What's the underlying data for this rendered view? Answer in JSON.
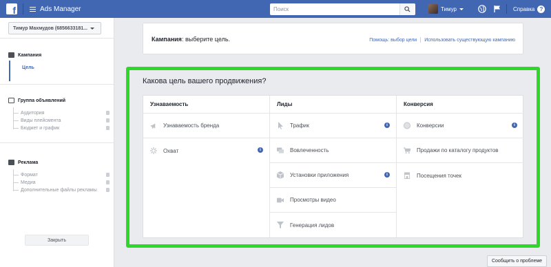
{
  "topbar": {
    "app_title": "Ads Manager",
    "search_placeholder": "Поиск",
    "user_name": "Тимур",
    "help_label": "Справка"
  },
  "sidebar": {
    "account_label": "Тимур Махмудов (6856633181...",
    "sections": [
      {
        "title": "Кампания",
        "active_sub": "Цель"
      },
      {
        "title": "Группа объявлений",
        "items": [
          "Аудитория",
          "Виды плейсмента",
          "Бюджет и график"
        ]
      },
      {
        "title": "Реклама",
        "items": [
          "Формат",
          "Медиа",
          "Дополнительные файлы рекламы"
        ]
      }
    ],
    "close_label": "Закрыть"
  },
  "campaign": {
    "title_bold": "Кампания",
    "title_rest": ": выберите цель.",
    "link_help": "Помощь: выбор цели",
    "link_existing": "Использовать существующую кампанию"
  },
  "objectives": {
    "question": "Какова цель вашего продвижения?",
    "columns": [
      {
        "header": "Узнаваемость",
        "items": [
          {
            "label": "Узнаваемость бренда",
            "icon": "megaphone-icon",
            "info": false
          },
          {
            "label": "Охват",
            "icon": "sparkle-icon",
            "info": true
          }
        ]
      },
      {
        "header": "Лиды",
        "items": [
          {
            "label": "Трафик",
            "icon": "cursor-icon",
            "info": true
          },
          {
            "label": "Вовлеченность",
            "icon": "chat-icon",
            "info": false
          },
          {
            "label": "Установки приложения",
            "icon": "box-icon",
            "info": true
          },
          {
            "label": "Просмотры видео",
            "icon": "video-icon",
            "info": false
          },
          {
            "label": "Генерация лидов",
            "icon": "funnel-icon",
            "info": false
          }
        ]
      },
      {
        "header": "Конверсия",
        "items": [
          {
            "label": "Конверсии",
            "icon": "globe-icon",
            "info": true
          },
          {
            "label": "Продажи по каталогу продуктов",
            "icon": "cart-icon",
            "info": false
          },
          {
            "label": "Посещения точек",
            "icon": "store-icon",
            "info": false
          }
        ]
      }
    ],
    "info_glyph": "i"
  },
  "footer": {
    "report_label": "Сообщить о проблеме"
  },
  "colors": {
    "brand": "#4267b2",
    "highlight": "#2fd72a"
  }
}
